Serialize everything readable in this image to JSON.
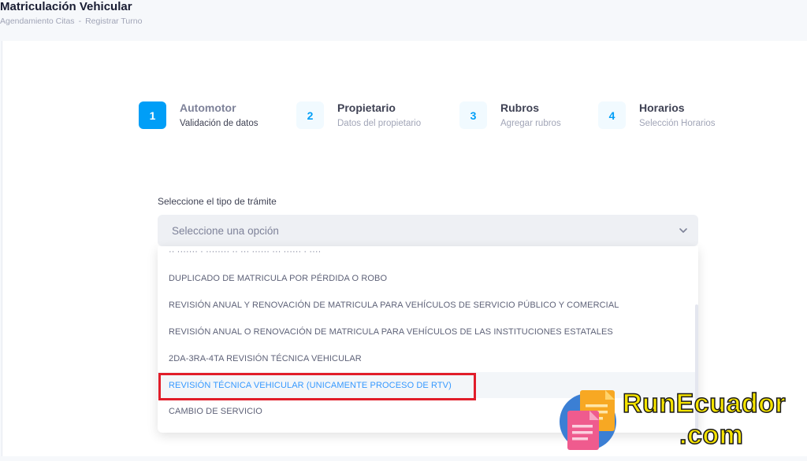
{
  "header": {
    "title": "Matriculación Vehicular",
    "breadcrumb": [
      "Agendamiento Citas",
      "Registrar Turno"
    ],
    "breadcrumb_separator": "-"
  },
  "stepper": {
    "steps": [
      {
        "number": "1",
        "title": "Automotor",
        "desc": "Validación de datos",
        "active": true
      },
      {
        "number": "2",
        "title": "Propietario",
        "desc": "Datos del propietario",
        "active": false
      },
      {
        "number": "3",
        "title": "Rubros",
        "desc": "Agregar rubros",
        "active": false
      },
      {
        "number": "4",
        "title": "Horarios",
        "desc": "Selección Horarios",
        "active": false
      }
    ]
  },
  "form": {
    "label": "Seleccione el tipo de trámite",
    "select_placeholder": "Seleccione una opción",
    "options": [
      "DUPLICADO DE MATRICULA POR PÉRDIDA O ROBO",
      "REVISIÓN ANUAL Y RENOVACIÓN DE MATRICULA PARA VEHÍCULOS DE SERVICIO PÚBLICO Y COMERCIAL",
      "REVISIÓN ANUAL O RENOVACIÓN DE MATRICULA PARA VEHÍCULOS DE LAS INSTITUCIONES ESTATALES",
      "2DA-3RA-4TA REVISIÓN TÉCNICA VEHICULAR",
      "REVISIÓN TÉCNICA VEHICULAR (UNICAMENTE PROCESO DE RTV)",
      "CAMBIO DE SERVICIO"
    ],
    "selected_index": 4
  },
  "watermark": {
    "line1": "RunEcuador",
    "line2": ".com"
  },
  "colors": {
    "primary": "#009ef7",
    "highlight_border": "#e11d2a",
    "logo_yellow": "#f6e400"
  }
}
